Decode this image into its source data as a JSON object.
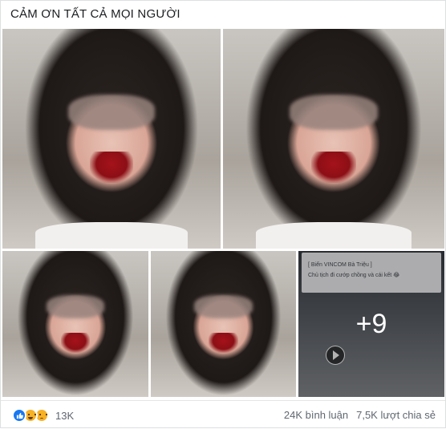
{
  "post": {
    "caption": "CẢM ƠN TẤT CẢ MỌI NGƯỜI"
  },
  "photos": {
    "count": 5,
    "last_tile": {
      "screenshot_line_1": "[ Biển VINCOM Bà Triệu ]",
      "screenshot_line_2": "Chủ tịch đi cướp chồng và cái kết 😂",
      "more_label": "+9"
    }
  },
  "reactions": {
    "types": [
      "like-icon",
      "haha-icon",
      "sad-icon"
    ],
    "count_label": "13K"
  },
  "stats": {
    "comments": "24K bình luận",
    "shares": "7,5K lượt chia sẻ"
  },
  "colors": {
    "like_blue": "#1877f2",
    "emoji_yellow": "#f7b125",
    "meta_text": "#606770"
  }
}
